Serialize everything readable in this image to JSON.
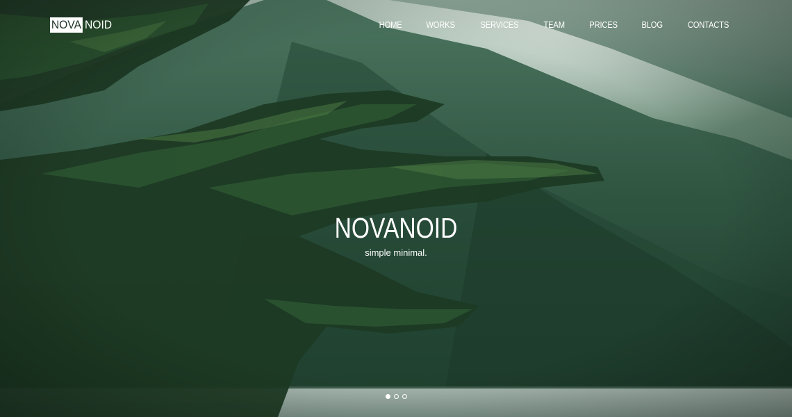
{
  "brand": {
    "logo_boxed": "NOVA",
    "logo_rest": "NOID"
  },
  "nav": {
    "items": [
      {
        "label": "HOME"
      },
      {
        "label": "WORKS"
      },
      {
        "label": "SERVICES"
      },
      {
        "label": "TEAM"
      },
      {
        "label": "PRICES"
      },
      {
        "label": "BLOG"
      },
      {
        "label": "CONTACTS"
      }
    ]
  },
  "hero": {
    "title": "NOVANOID",
    "subtitle": "simple minimal.",
    "background_description_icon": "forest-mountain-lake-photo",
    "slider": {
      "count": 3,
      "active_index": 0
    }
  },
  "colors": {
    "text": "#ffffff",
    "logo_box_bg": "#ffffff",
    "logo_box_text": "#21362b",
    "forest_dark": "#1c3324",
    "forest_mid": "#3f6a50",
    "mist": "#9bb3a4",
    "water": "#8fa39a"
  }
}
